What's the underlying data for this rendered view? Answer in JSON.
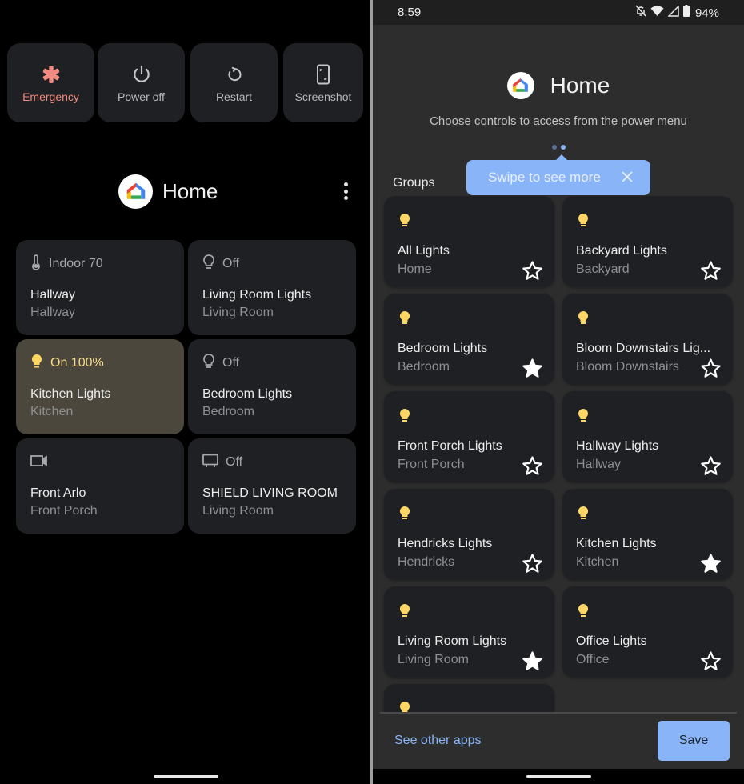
{
  "left_panel": {
    "power_actions": [
      {
        "label": "Emergency",
        "icon": "emergency-asterisk-icon",
        "color": "#f28b82"
      },
      {
        "label": "Power off",
        "icon": "power-icon"
      },
      {
        "label": "Restart",
        "icon": "restart-icon"
      },
      {
        "label": "Screenshot",
        "icon": "screenshot-icon"
      }
    ],
    "header": {
      "title": "Home",
      "icon": "google-home-icon",
      "menu_icon": "more-vert-icon"
    },
    "controls": [
      {
        "status": "Indoor 70",
        "icon": "thermometer-icon",
        "title": "Hallway",
        "subtitle": "Hallway",
        "on": false
      },
      {
        "status": "Off",
        "icon": "lightbulb-outline-icon",
        "title": "Living Room Lights",
        "subtitle": "Living Room",
        "on": false
      },
      {
        "status": "On 100%",
        "icon": "lightbulb-filled-icon",
        "title": "Kitchen Lights",
        "subtitle": "Kitchen",
        "on": true
      },
      {
        "status": "Off",
        "icon": "lightbulb-outline-icon",
        "title": "Bedroom Lights",
        "subtitle": "Bedroom",
        "on": false
      },
      {
        "status": "",
        "icon": "camera-icon",
        "title": "Front Arlo",
        "subtitle": "Front Porch",
        "on": false
      },
      {
        "status": "Off",
        "icon": "tv-icon",
        "title": "SHIELD LIVING ROOM",
        "subtitle": "Living Room",
        "on": false
      }
    ]
  },
  "right_panel": {
    "status_bar": {
      "time": "8:59",
      "battery": "94%",
      "icons": [
        "notifications-off-icon",
        "wifi-icon",
        "signal-icon",
        "battery-icon"
      ]
    },
    "header": {
      "title": "Home",
      "icon": "google-home-icon"
    },
    "subtitle": "Choose controls to access from the power menu",
    "page_indicator": {
      "pages": 2,
      "current": 2
    },
    "tooltip": {
      "text": "Swipe to see more",
      "close_icon": "close-icon"
    },
    "section_label": "Groups",
    "favorites": [
      {
        "title": "All Lights",
        "subtitle": "Home",
        "favorited": false
      },
      {
        "title": "Backyard Lights",
        "subtitle": "Backyard",
        "favorited": false
      },
      {
        "title": "Bedroom Lights",
        "subtitle": "Bedroom",
        "favorited": true
      },
      {
        "title": "Bloom Downstairs Lig...",
        "subtitle": "Bloom Downstairs",
        "favorited": false
      },
      {
        "title": "Front Porch Lights",
        "subtitle": "Front Porch",
        "favorited": false
      },
      {
        "title": "Hallway Lights",
        "subtitle": "Hallway",
        "favorited": false
      },
      {
        "title": "Hendricks Lights",
        "subtitle": "Hendricks",
        "favorited": false
      },
      {
        "title": "Kitchen Lights",
        "subtitle": "Kitchen",
        "favorited": true
      },
      {
        "title": "Living Room Lights",
        "subtitle": "Living Room",
        "favorited": true
      },
      {
        "title": "Office Lights",
        "subtitle": "Office",
        "favorited": false
      },
      {
        "title": "",
        "subtitle": "",
        "favorited": false
      }
    ],
    "footer": {
      "see_other_label": "See other apps",
      "save_label": "Save"
    }
  },
  "colors": {
    "accent": "#8ab4f8",
    "bulb_on": "#fdd663",
    "emergency": "#f28b82",
    "card": "#1f2023",
    "card_on": "#4c473c"
  }
}
